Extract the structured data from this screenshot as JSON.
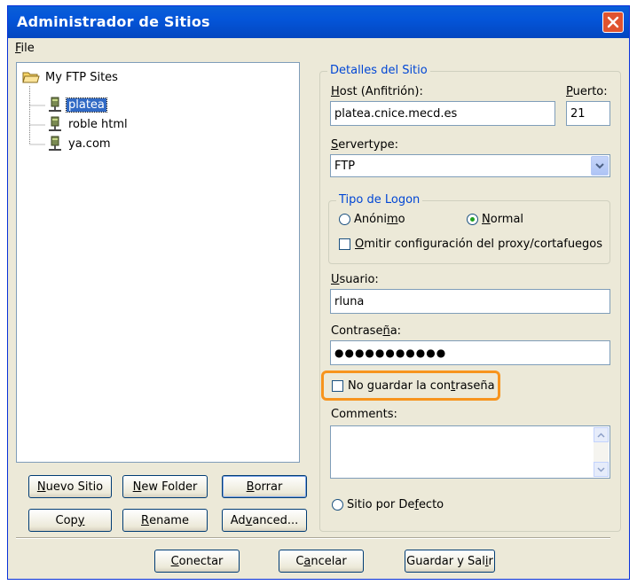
{
  "window": {
    "title": "Administrador de Sitios"
  },
  "menu": {
    "file_first": "F",
    "file_rest": "ile"
  },
  "tree": {
    "root_label": "My FTP Sites",
    "items": [
      {
        "label": "platea",
        "selected": true
      },
      {
        "label": "roble html",
        "selected": false
      },
      {
        "label": "ya.com",
        "selected": false
      }
    ]
  },
  "left_buttons": {
    "nuevo_sitio": {
      "pre": "",
      "ul": "N",
      "post": "uevo Sitio"
    },
    "new_folder": {
      "pre": "",
      "ul": "N",
      "post": "ew Folder"
    },
    "borrar": {
      "pre": "",
      "ul": "B",
      "post": "orrar"
    },
    "copy": {
      "pre": "Cop",
      "ul": "y",
      "post": ""
    },
    "rename": {
      "pre": "",
      "ul": "R",
      "post": "ename"
    },
    "advanced": {
      "pre": "Ad",
      "ul": "v",
      "post": "anced..."
    }
  },
  "details": {
    "legend": "Detalles del Sitio",
    "host_label": {
      "pre": "",
      "ul": "H",
      "post": "ost (Anfitrión):"
    },
    "host_value": "platea.cnice.mecd.es",
    "port_label": {
      "pre": "",
      "ul": "P",
      "post": "uerto:"
    },
    "port_value": "21",
    "servertype_label": {
      "pre": "",
      "ul": "S",
      "post": "ervertype:"
    },
    "servertype_value": "FTP",
    "logon": {
      "legend": "Tipo de Logon",
      "anon": {
        "pre": "Anóni",
        "ul": "m",
        "post": "o"
      },
      "normal": {
        "pre": "",
        "ul": "N",
        "post": "ormal"
      },
      "proxy": {
        "pre": "",
        "ul": "O",
        "post": "mitir configuración del proxy/cortafuegos"
      }
    },
    "user_label": {
      "pre": "",
      "ul": "U",
      "post": "suario:"
    },
    "user_value": "rluna",
    "pass_label": {
      "pre": "Contrase",
      "ul": "ñ",
      "post": "a:"
    },
    "pass_value": "●●●●●●●●●●●",
    "nosave": {
      "pre": "No guardar la con",
      "ul": "t",
      "post": "raseña"
    },
    "comments_label": "Comments:",
    "default_site": {
      "pre": "Sitio por De",
      "ul": "f",
      "post": "ecto"
    }
  },
  "bottom_buttons": {
    "conectar": {
      "pre": "",
      "ul": "C",
      "post": "onectar"
    },
    "cancelar": {
      "pre": "C",
      "ul": "a",
      "post": "ncelar"
    },
    "guardar": {
      "pre": "Guardar y Sal",
      "ul": "i",
      "post": "r"
    }
  },
  "colors": {
    "title_bar": "#0455d9",
    "close": "#e0532f",
    "highlight": "#f7941d",
    "selection": "#316ac5"
  }
}
